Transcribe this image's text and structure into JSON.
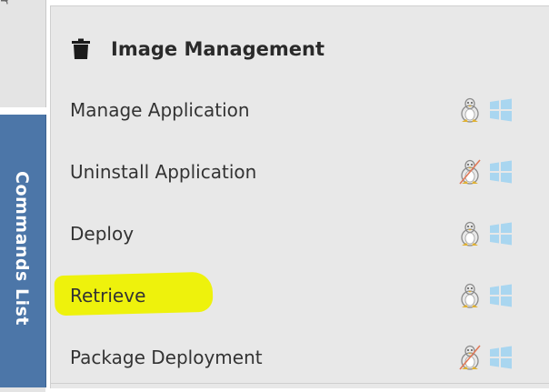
{
  "sidebar": {
    "top_label": "or",
    "tab_label": "Commands List"
  },
  "panel": {
    "title": "Image Management",
    "title_icon": "trash-bin-icon",
    "commands": [
      {
        "label": "Manage Application",
        "linux": "available",
        "windows": "available"
      },
      {
        "label": "Uninstall Application",
        "linux": "unavailable",
        "windows": "available"
      },
      {
        "label": "Deploy",
        "linux": "available",
        "windows": "available"
      },
      {
        "label": "Retrieve",
        "linux": "available",
        "windows": "available",
        "highlighted": true
      },
      {
        "label": "Package Deployment",
        "linux": "unavailable",
        "windows": "available"
      }
    ]
  },
  "colors": {
    "tab_background": "#4c76a8",
    "highlight": "#eef200",
    "windows_icon": "#a9d6f0",
    "unavailable_cross": "#e07a5a"
  }
}
